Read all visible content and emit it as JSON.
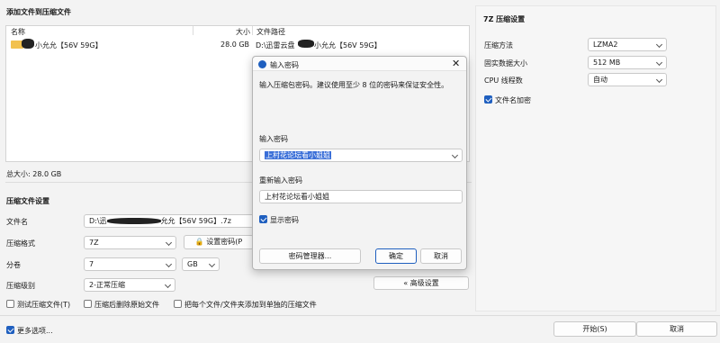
{
  "section_title": "添加文件到压缩文件",
  "columns": {
    "name": "名称",
    "size": "大小",
    "path": "文件路径"
  },
  "files": [
    {
      "name": "小允允【56V 59G】",
      "size": "28.0 GB",
      "path_prefix": "D:\\迅雷云盘",
      "path_suffix": "小允允【56V 59G】"
    }
  ],
  "total_size": "总大小: 28.0 GB",
  "compression_settings": {
    "title": "压缩文件设置",
    "filename_label": "文件名",
    "filename_prefix": "D:\\迅",
    "filename_suffix": "允允【56V 59G】.7z",
    "format_label": "压缩格式",
    "format_value": "7Z",
    "set_password_label": "设置密码(P",
    "split_label": "分卷",
    "split_value": "7",
    "split_unit": "GB",
    "level_label": "压缩级别",
    "level_value": "2-正常压缩",
    "advanced_label": "« 高级设置"
  },
  "options": {
    "test": "测试压缩文件(T)",
    "delete_source": "压缩后删除原始文件",
    "each_separate": "把每个文件/文件夹添加到单独的压缩文件"
  },
  "more_options": "更多选项...",
  "start_button": "开始(S)",
  "cancel_button": "取消",
  "sevenzip": {
    "title": "7Z 压缩设置",
    "method_label": "压缩方法",
    "method_value": "LZMA2",
    "solid_label": "固实数据大小",
    "solid_value": "512 MB",
    "threads_label": "CPU 线程数",
    "threads_value": "自动",
    "encrypt_names_label": "文件名加密"
  },
  "dialog": {
    "title": "输入密码",
    "message": "输入压缩包密码。建议使用至少 8 位的密码来保证安全性。",
    "password_label": "输入密码",
    "password_value": "上村花论坛看小姐姐",
    "reenter_label": "重新输入密码",
    "reenter_value": "上村花论坛看小姐姐",
    "show_password_label": "显示密码",
    "manager_button": "密码管理器...",
    "ok_button": "确定",
    "cancel_button": "取消"
  },
  "colors": {
    "accent": "#1f5fbf",
    "selection": "#3a6fd8"
  },
  "icons": [
    "folder-icon",
    "app-logo-icon",
    "shield-icon",
    "close-icon"
  ]
}
